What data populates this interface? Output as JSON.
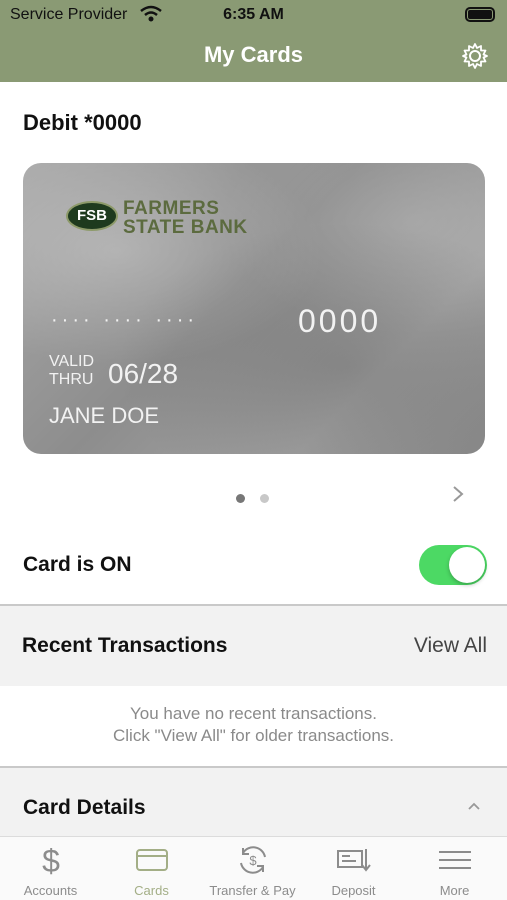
{
  "status_bar": {
    "carrier": "Service Provider",
    "time": "6:35 AM"
  },
  "nav": {
    "title": "My Cards",
    "settings_icon": "gear-icon"
  },
  "card_section": {
    "title": "Debit *0000"
  },
  "card": {
    "logo_text": "FSB",
    "bank_name_line1": "FARMERS",
    "bank_name_line2": "STATE BANK",
    "masked_number": "···· ···· ····",
    "last4": "0000",
    "valid_line1": "VALID",
    "valid_line2": "THRU",
    "expiry": "06/28",
    "holder": "JANE DOE"
  },
  "pager": {
    "pages": 2,
    "current": 1
  },
  "card_status": {
    "label": "Card is ON",
    "enabled": true,
    "accent": "#4cd964"
  },
  "recent": {
    "title": "Recent Transactions",
    "view_all": "View All",
    "empty_line1": "You have no recent transactions.",
    "empty_line2": "Click \"View All\" for older transactions."
  },
  "details": {
    "title": "Card Details"
  },
  "tabs": [
    {
      "label": "Accounts",
      "icon": "dollar-icon",
      "active": false
    },
    {
      "label": "Cards",
      "icon": "card-icon",
      "active": true
    },
    {
      "label": "Transfer & Pay",
      "icon": "transfer-icon",
      "active": false
    },
    {
      "label": "Deposit",
      "icon": "deposit-icon",
      "active": false
    },
    {
      "label": "More",
      "icon": "menu-icon",
      "active": false
    }
  ],
  "colors": {
    "header": "#8a9a74",
    "active_tab": "#a3ae86",
    "bank_name": "#5c6b3f"
  }
}
